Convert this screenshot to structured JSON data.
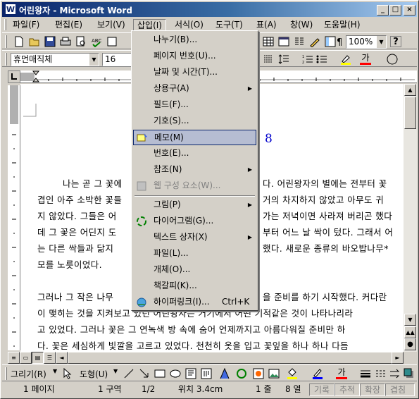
{
  "window": {
    "title": "어린왕자 - Microsoft Word",
    "app_icon": "W"
  },
  "caption_buttons": {
    "minimize": "_",
    "maximize": "□",
    "close": "×"
  },
  "menubar": {
    "items": [
      "파일(F)",
      "편집(E)",
      "보기(V)",
      "삽입(I)",
      "서식(O)",
      "도구(T)",
      "표(A)",
      "창(W)",
      "도움말(H)"
    ],
    "active": "삽입(I)"
  },
  "toolbar": {
    "zoom": "100%",
    "help_symbol": "?"
  },
  "format_toolbar": {
    "font_name": "휴먼매직체",
    "font_size": "16",
    "font_color_glyph": "가"
  },
  "document": {
    "heading_fragment": "8",
    "lines": [
      "나는 곧 그 꽃에",
      "겹인 아주 소박한 꽃들",
      "지 않았다. 그들은 어",
      "데 그 꽃은 어딘지 도",
      "는 다른 싹들과 닮지",
      "모를 노릇이었다.",
      "",
      "그러나 그 작은 나무",
      "이 맺히는 것을 지켜보고 있던 어린왕자는 거기에서 어떤 기적같은 것이 나타나리라",
      "고 있었다. 그러나 꽃은 그 연녹색 방 속에 숨어 언제까지고 아름다워질 준비만 하",
      "다. 꽃은 세심하게 빛깔을 고르고 있었다. 천천히 옷을 입고 꽃잎을 하나 하나 다듬"
    ],
    "right_fragments": [
      "다. 어린왕자의 별에는 전부터 꽃",
      "거의 차지하지 않았고 아무도 귀",
      "가는 저녁이면 사라져 버리곤 했다",
      "부터 어느 날 싹이 텄다. 그래서 어",
      "했다. 새로운 종류의 바오밥나무*",
      "을 준비를 하기 시작했다. 커다란"
    ]
  },
  "insert_menu": {
    "items": [
      {
        "label": "나누기(B)...",
        "shortcut": "",
        "submenu": false,
        "icon": "",
        "disabled": false,
        "highlighted": false
      },
      {
        "label": "페이지 번호(U)...",
        "shortcut": "",
        "submenu": false,
        "icon": "",
        "disabled": false,
        "highlighted": false
      },
      {
        "label": "날짜 및 시간(T)...",
        "shortcut": "",
        "submenu": false,
        "icon": "",
        "disabled": false,
        "highlighted": false
      },
      {
        "label": "상용구(A)",
        "shortcut": "",
        "submenu": true,
        "icon": "",
        "disabled": false,
        "highlighted": false
      },
      {
        "label": "필드(F)...",
        "shortcut": "",
        "submenu": false,
        "icon": "",
        "disabled": false,
        "highlighted": false
      },
      {
        "label": "기호(S)...",
        "shortcut": "",
        "submenu": false,
        "icon": "",
        "disabled": false,
        "highlighted": false
      },
      {
        "label": "메모(M)",
        "shortcut": "",
        "submenu": false,
        "icon": "comment-icon",
        "disabled": false,
        "highlighted": true
      },
      {
        "label": "번호(E)...",
        "shortcut": "",
        "submenu": false,
        "icon": "",
        "disabled": false,
        "highlighted": false
      },
      {
        "label": "참조(N)",
        "shortcut": "",
        "submenu": true,
        "icon": "",
        "disabled": false,
        "highlighted": false
      },
      {
        "label": "웹 구성 요소(W)...",
        "shortcut": "",
        "submenu": false,
        "icon": "web-component-icon",
        "disabled": true,
        "highlighted": false
      },
      {
        "label": "그림(P)",
        "shortcut": "",
        "submenu": true,
        "icon": "",
        "disabled": false,
        "highlighted": false
      },
      {
        "label": "다이어그램(G)...",
        "shortcut": "",
        "submenu": false,
        "icon": "diagram-icon",
        "disabled": false,
        "highlighted": false
      },
      {
        "label": "텍스트 상자(X)",
        "shortcut": "",
        "submenu": true,
        "icon": "",
        "disabled": false,
        "highlighted": false
      },
      {
        "label": "파일(L)...",
        "shortcut": "",
        "submenu": false,
        "icon": "",
        "disabled": false,
        "highlighted": false
      },
      {
        "label": "개체(O)...",
        "shortcut": "",
        "submenu": false,
        "icon": "",
        "disabled": false,
        "highlighted": false
      },
      {
        "label": "책갈피(K)...",
        "shortcut": "",
        "submenu": false,
        "icon": "",
        "disabled": false,
        "highlighted": false
      },
      {
        "label": "하이퍼링크(I)...",
        "shortcut": "Ctrl+K",
        "submenu": false,
        "icon": "hyperlink-icon",
        "disabled": false,
        "highlighted": false
      }
    ]
  },
  "drawing_toolbar": {
    "draw_label": "그리기(R)",
    "autoshape_label": "도형(U)",
    "font_color_glyph": "가"
  },
  "statusbar": {
    "page": "1 페이지",
    "section": "1 구역",
    "page_of": "1/2",
    "position": "위치 3.4cm",
    "line": "1 줄",
    "column": "8 열",
    "rec": "기록",
    "trk": "추적",
    "ext": "확장",
    "ovr": "겹침"
  },
  "colors": {
    "title_start": "#0a246a",
    "title_end": "#a6caf0",
    "menu_highlight": "#b6bdd2",
    "heading_blue": "#0000cc"
  }
}
